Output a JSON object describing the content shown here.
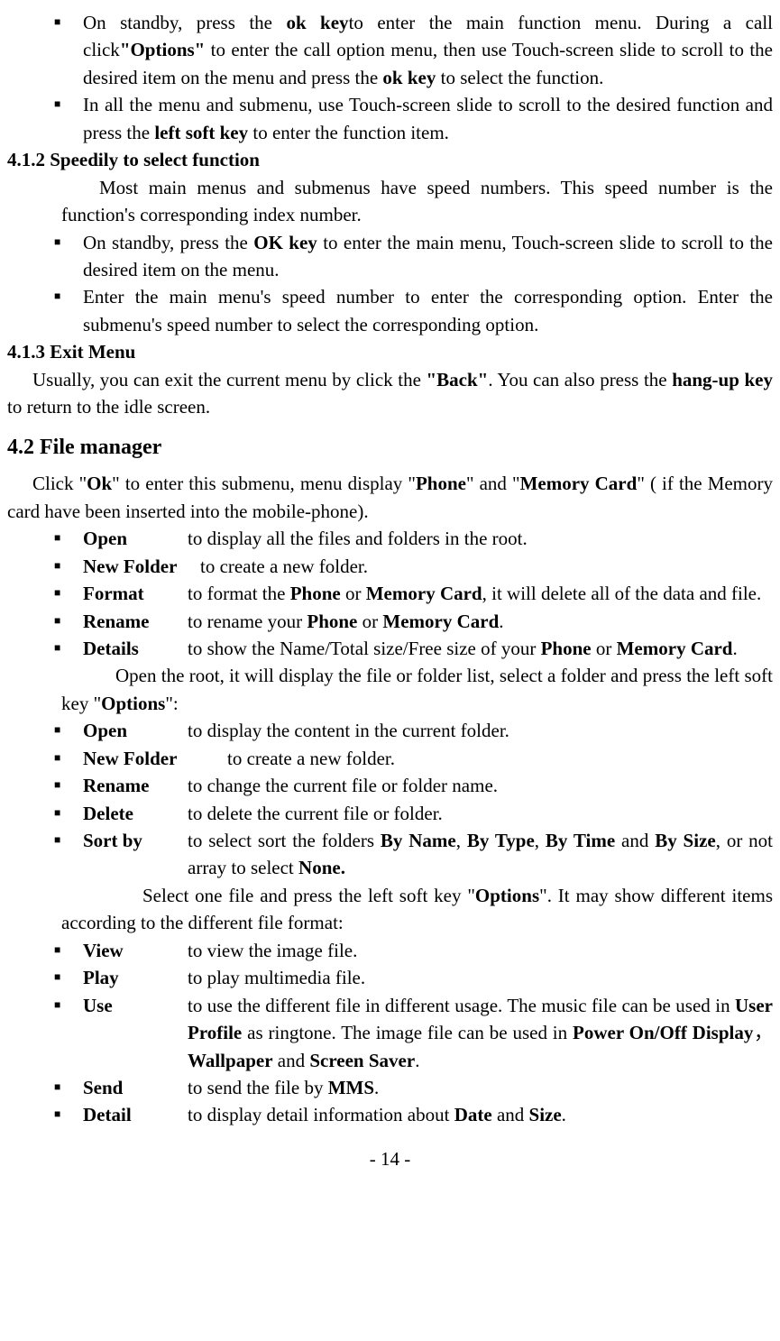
{
  "bullets1": [
    {
      "prefix": "On standby, press the ",
      "b1": "ok key",
      "mid1": "to enter the main function menu. During a call click",
      "b2": "\"Options\"",
      "mid2": " to enter the call option menu, then use Touch-screen slide to scroll to the desired item on the menu and press the ",
      "b3": "ok key",
      "suffix": " to select the function."
    },
    {
      "text1": "In all the menu and submenu, use Touch-screen slide to scroll to the desired function and press the ",
      "b1": "left soft key",
      "text2": " to enter the function item."
    }
  ],
  "heading412": "4.1.2 Speedily to select function",
  "para412": "Most main menus and submenus have speed numbers. This speed number is the function's corresponding index number.",
  "bullets2": [
    {
      "text1": "On standby, press the ",
      "b1": "OK key",
      "text2": " to enter the main menu, Touch-screen slide to scroll to the desired item on the menu."
    },
    {
      "text": "Enter the main menu's speed number to enter the corresponding option. Enter the submenu's speed number to select the corresponding option."
    }
  ],
  "heading413": "4.1.3 Exit Menu",
  "para413": {
    "t1": "Usually, you can exit the current menu by click the ",
    "b1": "\"Back\"",
    "t2": ". You can also press the ",
    "b2": "hang-up key",
    "t3": " to return to the idle screen."
  },
  "heading42": "4.2 File manager",
  "para42": {
    "t1": "Click \"",
    "b1": "Ok",
    "t2": "\" to enter this submenu, menu display \"",
    "b2": "Phone",
    "t3": "\" and \"",
    "b3": "Memory Card",
    "t4": "\" ( if the Memory card have been inserted into the mobile-phone)."
  },
  "defs1": [
    {
      "term": "Open",
      "desc": "to display all the files and folders in the root."
    },
    {
      "term": "New Folder",
      "desc": "to create a new folder."
    },
    {
      "term": "Format",
      "desc_t1": "to format the ",
      "desc_b1": "Phone",
      "desc_t2": " or ",
      "desc_b2": "Memory Card",
      "desc_t3": ", it will delete all of the data and file."
    },
    {
      "term": "Rename",
      "desc_t1": "to rename your ",
      "desc_b1": "Phone",
      "desc_t2": " or ",
      "desc_b2": "Memory Card",
      "desc_t3": "."
    },
    {
      "term": "Details",
      "desc_t1": "to show the Name/Total size/Free size of your ",
      "desc_b1": "Phone",
      "desc_t2": " or ",
      "desc_b2": "Memory Card",
      "desc_t3": "."
    }
  ],
  "para_folder": {
    "t1": "Open the root, it will display the file or folder list, select a folder and press the left soft key \"",
    "b1": "Options",
    "t2": "\":"
  },
  "defs2": [
    {
      "term": "Open",
      "desc": "to display the content in the current folder."
    },
    {
      "term": "New Folder",
      "desc": "to create a new folder."
    },
    {
      "term": "Rename",
      "desc": "to change the current file or folder name."
    },
    {
      "term": "Delete",
      "desc": "to delete the current file or folder."
    },
    {
      "term": "Sort by",
      "desc_t1": "to select sort the folders ",
      "desc_b1": "By Name",
      "desc_t2": ", ",
      "desc_b2": "By Type",
      "desc_t3": ", ",
      "desc_b3": "By Time",
      "desc_t4": " and ",
      "desc_b4": "By Size",
      "desc_t5": ", or not array to select ",
      "desc_b5": "None."
    }
  ],
  "para_file": {
    "t1": "Select one file and press the left soft key \"",
    "b1": "Options",
    "t2": "\". It may show different items according to the different file format:"
  },
  "defs3": [
    {
      "term": "View",
      "desc": "to view the image file."
    },
    {
      "term": "Play",
      "desc": "to play multimedia file."
    },
    {
      "term": "Use",
      "desc_t1": "to use the different file in different usage. The music file can be used in ",
      "desc_b1": "User Profile",
      "desc_t2": " as ringtone. The image file can be used in ",
      "desc_b2": "Power On/Off Display",
      "desc_t3": "，",
      "desc_b3": "Wallpaper",
      "desc_t4": " and ",
      "desc_b4": "Screen Saver",
      "desc_t5": "."
    },
    {
      "term": "Send",
      "desc_t1": "to send the file by ",
      "desc_b1": "MMS",
      "desc_t2": "."
    },
    {
      "term": "Detail",
      "desc_t1": "to display detail information about ",
      "desc_b1": "Date",
      "desc_t2": " and ",
      "desc_b2": "Size",
      "desc_t3": "."
    }
  ],
  "page_num": "- 14 -"
}
